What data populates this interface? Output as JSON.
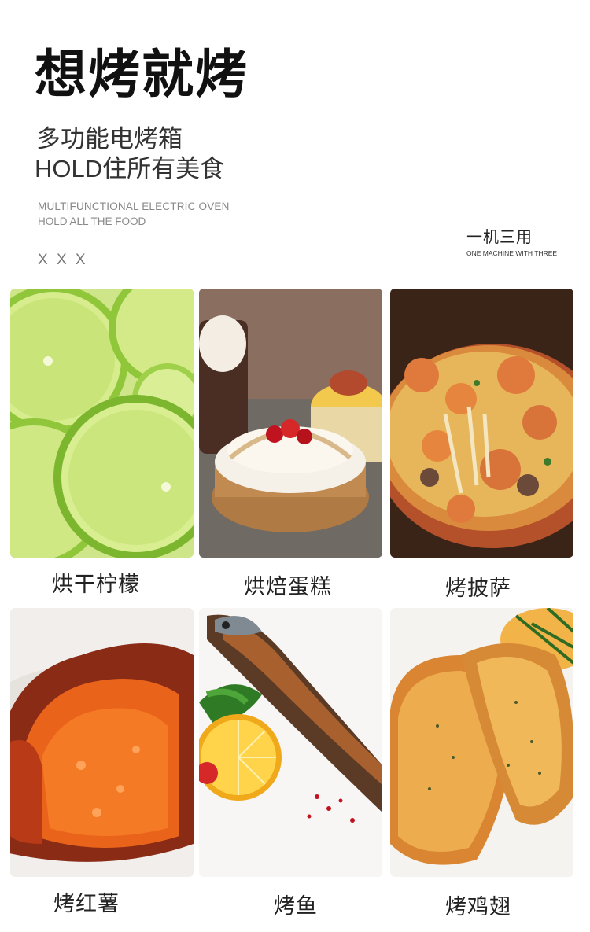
{
  "header": {
    "title": "想烤就烤",
    "subtitle_line1": "多功能电烤箱",
    "subtitle_line2": "HOLD住所有美食",
    "english_line1": "MULTIFUNCTIONAL ELECTRIC OVEN",
    "english_line2": "HOLD ALL THE FOOD",
    "placeholder_mark": "X X X"
  },
  "side_note": {
    "cn": "一机三用",
    "en": "ONE MACHINE WITH THREE"
  },
  "grid": {
    "items": [
      {
        "label": "烘干柠檬",
        "icon": "lime-slices-photo"
      },
      {
        "label": "烘焙蛋糕",
        "icon": "tart-cake-photo"
      },
      {
        "label": "烤披萨",
        "icon": "pizza-photo"
      },
      {
        "label": "烤红薯",
        "icon": "sweet-potato-photo"
      },
      {
        "label": "烤鱼",
        "icon": "grilled-fish-photo"
      },
      {
        "label": "烤鸡翅",
        "icon": "chicken-wings-photo"
      }
    ]
  },
  "colors": {
    "title": "#111111",
    "subtitle": "#333333",
    "english": "#888888"
  }
}
